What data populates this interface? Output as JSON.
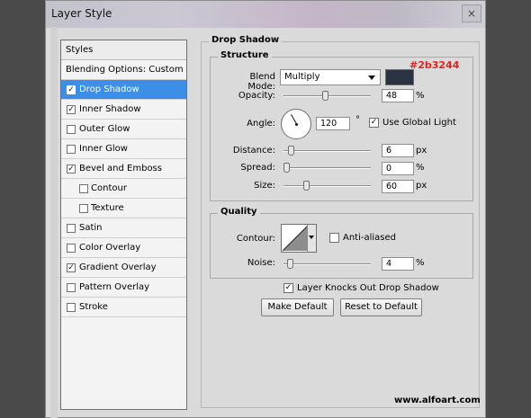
{
  "window": {
    "title": "Layer Style",
    "close_glyph": "×"
  },
  "styles": {
    "header": "Styles",
    "blending": "Blending Options: Custom",
    "items": [
      {
        "label": "Drop Shadow",
        "checked": true,
        "selected": true,
        "sub": false
      },
      {
        "label": "Inner Shadow",
        "checked": true,
        "selected": false,
        "sub": false
      },
      {
        "label": "Outer Glow",
        "checked": false,
        "selected": false,
        "sub": false
      },
      {
        "label": "Inner Glow",
        "checked": false,
        "selected": false,
        "sub": false
      },
      {
        "label": "Bevel and Emboss",
        "checked": true,
        "selected": false,
        "sub": false
      },
      {
        "label": "Contour",
        "checked": false,
        "selected": false,
        "sub": true
      },
      {
        "label": "Texture",
        "checked": false,
        "selected": false,
        "sub": true
      },
      {
        "label": "Satin",
        "checked": false,
        "selected": false,
        "sub": false
      },
      {
        "label": "Color Overlay",
        "checked": false,
        "selected": false,
        "sub": false
      },
      {
        "label": "Gradient Overlay",
        "checked": true,
        "selected": false,
        "sub": false
      },
      {
        "label": "Pattern Overlay",
        "checked": false,
        "selected": false,
        "sub": false
      },
      {
        "label": "Stroke",
        "checked": false,
        "selected": false,
        "sub": false
      }
    ]
  },
  "drop_shadow": {
    "title": "Drop Shadow",
    "structure": {
      "label": "Structure",
      "blend_mode_label": "Blend Mode:",
      "blend_mode": "Multiply",
      "color_hex": "#2b3244",
      "color_label": "#2b3244",
      "opacity_label": "Opacity:",
      "opacity": "48",
      "opacity_unit": "%",
      "angle_label": "Angle:",
      "angle": "120",
      "angle_unit": "°",
      "use_global_light_label": "Use Global Light",
      "use_global_light": true,
      "distance_label": "Distance:",
      "distance": "6",
      "distance_unit": "px",
      "spread_label": "Spread:",
      "spread": "0",
      "spread_unit": "%",
      "size_label": "Size:",
      "size": "60",
      "size_unit": "px"
    },
    "quality": {
      "label": "Quality",
      "contour_label": "Contour:",
      "anti_aliased_label": "Anti-aliased",
      "anti_aliased": false,
      "noise_label": "Noise:",
      "noise": "4",
      "noise_unit": "%"
    },
    "knockout_label": "Layer Knocks Out Drop Shadow",
    "knockout": true,
    "make_default": "Make Default",
    "reset_default": "Reset to Default"
  },
  "watermark": "www.alfoart.com",
  "colors": {
    "selection": "#3d8ee6",
    "hex_label": "#e8201a",
    "shadow": "#2b3244"
  },
  "sliders": {
    "opacity": 0.48,
    "distance": 0.06,
    "spread": 0.0,
    "size": 0.24,
    "noise": 0.04
  }
}
